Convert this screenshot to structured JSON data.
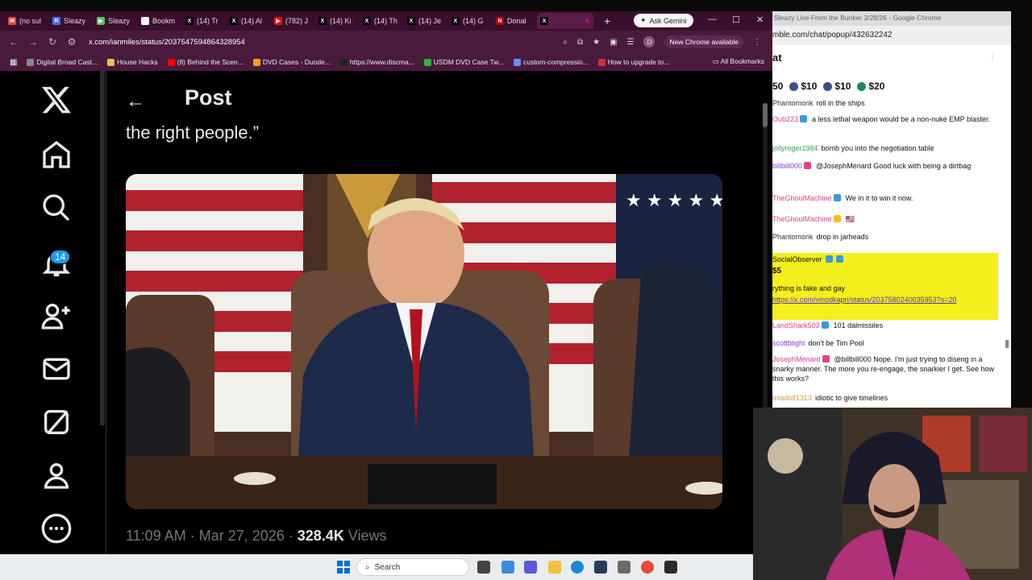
{
  "left_browser": {
    "tabs": [
      {
        "label": "(no sul",
        "color": "#ea4335",
        "glyph": "✉"
      },
      {
        "label": "Sleazy",
        "color": "#4a6cf7",
        "glyph": "R"
      },
      {
        "label": "Sleazy",
        "color": "#56c05a",
        "glyph": "▶"
      },
      {
        "label": "Bookm",
        "color": "#ffffff",
        "glyph": "★"
      },
      {
        "label": "(14) Tr",
        "color": "#000000",
        "glyph": "X"
      },
      {
        "label": "(14) Al",
        "color": "#000000",
        "glyph": "X"
      },
      {
        "label": "(782) J",
        "color": "#ff0000",
        "glyph": "▶"
      },
      {
        "label": "(14) Ki",
        "color": "#000000",
        "glyph": "X"
      },
      {
        "label": "(14) Th",
        "color": "#000000",
        "glyph": "X"
      },
      {
        "label": "(14) Je",
        "color": "#000000",
        "glyph": "X"
      },
      {
        "label": "(14) G",
        "color": "#000000",
        "glyph": "X"
      },
      {
        "label": "Donal",
        "color": "#b00",
        "glyph": "N"
      },
      {
        "label": "",
        "color": "#000000",
        "glyph": "X",
        "active": true
      }
    ],
    "gemini_label": "Ask Gemini",
    "url": "x.com/ianmiles/status/2037547594864328954",
    "new_chrome": "New Chrome available",
    "profile_letter": "D",
    "bookmarks": [
      {
        "label": "Digital Broad Cast...",
        "color": "#888"
      },
      {
        "label": "House Hacks",
        "color": "#e8c04a"
      },
      {
        "label": "(8) Behind the Scen...",
        "color": "#ff0000"
      },
      {
        "label": "DVD Cases - Duode...",
        "color": "#f0a020"
      },
      {
        "label": "https://www.discma...",
        "color": "#222"
      },
      {
        "label": "USDM DVD Case Tw...",
        "color": "#2bb34a"
      },
      {
        "label": "custom-compressio...",
        "color": "#6a8ef0"
      },
      {
        "label": "How to upgrade to...",
        "color": "#cc3333"
      }
    ],
    "all_bookmarks": "All Bookmarks"
  },
  "x_post": {
    "header": "Post",
    "text": "the right people.”",
    "timestamp": "11:09 AM · Mar 27, 2026 · ",
    "views_count": "328.4K",
    "views_label": "Views",
    "notification_count": "14"
  },
  "chat": {
    "window_title": "Sleazy Live From the Bunker 3/28/26 - Google Chrome",
    "url": "mble.com/chat/popup/432632242",
    "title": "at",
    "tips": [
      {
        "label": "50",
        "color": "#222"
      },
      {
        "label": "$10",
        "color": "#3d4e8a"
      },
      {
        "label": "$10",
        "color": "#3d4e8a"
      },
      {
        "label": "$20",
        "color": "#1a8a5a"
      }
    ],
    "messages": [
      {
        "user": "Phantomonk",
        "user_color": "#333",
        "text": "roll in the ships"
      },
      {
        "user": "Oub223",
        "user_color": "#e0428a",
        "text": "a less lethal weapon would be a non-nuke EMP blaster."
      },
      {
        "user": "jollyroger1984",
        "user_color": "#3a9a5a",
        "text": "bomb you into the negotiation table"
      },
      {
        "user": "billbill000",
        "user_color": "#8a3ad6",
        "text": "@JosephMenard Good luck with being a dirtbag"
      },
      {
        "user": "TheGhoulMachine",
        "user_color": "#e0428a",
        "text": "We in it to win it now."
      },
      {
        "user": "TheGhoulMachine",
        "user_color": "#e0428a",
        "text": "🇺🇸"
      },
      {
        "user": "Phantomonk",
        "user_color": "#333",
        "text": "drop in jarheads"
      },
      {
        "user": "LandShark503",
        "user_color": "#e0428a",
        "text": "101 dalmissiles"
      },
      {
        "user": "scottblight",
        "user_color": "#8a3ad6",
        "text": "don't be Tim Pool"
      },
      {
        "user": "JosephMenard",
        "user_color": "#e0428a",
        "text": "@billbill000 Nope. I'm just trying to diseng in a snarky manner. The more you re-engage, the snarkier I get. See how this works?"
      },
      {
        "user": "miadolf1313",
        "user_color": "#d69a3a",
        "text": "idiotic to give timelines"
      }
    ],
    "superchat": {
      "user": "SocialObserver",
      "amount": "$5",
      "text": "rything is fake and gay ",
      "link": "https://x.com/vinodkapri/status/2037580240035953?s=20"
    }
  },
  "taskbar": {
    "search_label": "Search"
  }
}
